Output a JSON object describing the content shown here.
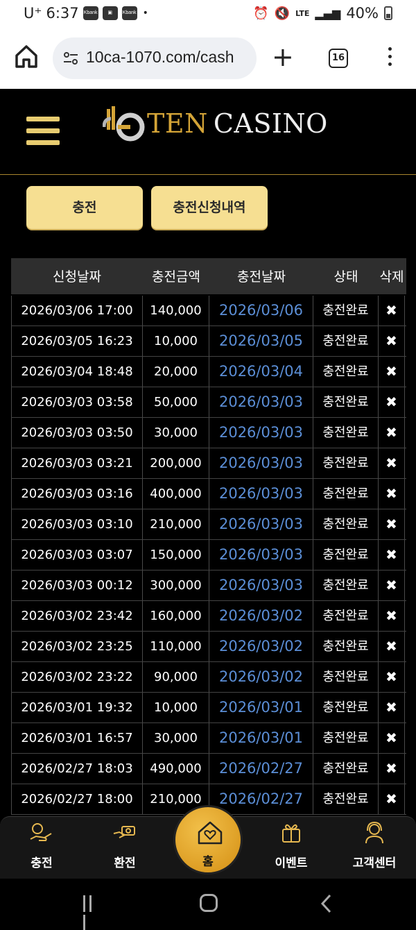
{
  "status_bar": {
    "carrier": "U⁺",
    "time": "6:37",
    "notif_icons": [
      "Kbank",
      "image",
      "Kbank"
    ],
    "more_dot": "•",
    "network": "LTE",
    "battery": "40%"
  },
  "browser": {
    "url": "10ca-1070.com/cash",
    "tab_count": "16",
    "home_icon": "home-icon",
    "new_tab_label": "+"
  },
  "site": {
    "logo_ten": "TEN",
    "logo_casino": "CASINO",
    "brand_color": "#d4a437"
  },
  "tabs": {
    "charge_label": "충전",
    "history_label": "충전신청내역"
  },
  "table": {
    "headers": [
      "신청날짜",
      "충전금액",
      "충전날짜",
      "상태",
      "삭제"
    ],
    "rows": [
      {
        "requested": "2026/03/06 17:00",
        "amount": "140,000",
        "charged": "2026/03/06",
        "status": "충전완료",
        "delete": "✖"
      },
      {
        "requested": "2026/03/05 16:23",
        "amount": "10,000",
        "charged": "2026/03/05",
        "status": "충전완료",
        "delete": "✖"
      },
      {
        "requested": "2026/03/04 18:48",
        "amount": "20,000",
        "charged": "2026/03/04",
        "status": "충전완료",
        "delete": "✖"
      },
      {
        "requested": "2026/03/03 03:58",
        "amount": "50,000",
        "charged": "2026/03/03",
        "status": "충전완료",
        "delete": "✖"
      },
      {
        "requested": "2026/03/03 03:50",
        "amount": "30,000",
        "charged": "2026/03/03",
        "status": "충전완료",
        "delete": "✖"
      },
      {
        "requested": "2026/03/03 03:21",
        "amount": "200,000",
        "charged": "2026/03/03",
        "status": "충전완료",
        "delete": "✖"
      },
      {
        "requested": "2026/03/03 03:16",
        "amount": "400,000",
        "charged": "2026/03/03",
        "status": "충전완료",
        "delete": "✖"
      },
      {
        "requested": "2026/03/03 03:10",
        "amount": "210,000",
        "charged": "2026/03/03",
        "status": "충전완료",
        "delete": "✖"
      },
      {
        "requested": "2026/03/03 03:07",
        "amount": "150,000",
        "charged": "2026/03/03",
        "status": "충전완료",
        "delete": "✖"
      },
      {
        "requested": "2026/03/03 00:12",
        "amount": "300,000",
        "charged": "2026/03/03",
        "status": "충전완료",
        "delete": "✖"
      },
      {
        "requested": "2026/03/02 23:42",
        "amount": "160,000",
        "charged": "2026/03/02",
        "status": "충전완료",
        "delete": "✖"
      },
      {
        "requested": "2026/03/02 23:25",
        "amount": "110,000",
        "charged": "2026/03/02",
        "status": "충전완료",
        "delete": "✖"
      },
      {
        "requested": "2026/03/02 23:22",
        "amount": "90,000",
        "charged": "2026/03/02",
        "status": "충전완료",
        "delete": "✖"
      },
      {
        "requested": "2026/03/01 19:32",
        "amount": "10,000",
        "charged": "2026/03/01",
        "status": "충전완료",
        "delete": "✖"
      },
      {
        "requested": "2026/03/01 16:57",
        "amount": "30,000",
        "charged": "2026/03/01",
        "status": "충전완료",
        "delete": "✖"
      },
      {
        "requested": "2026/02/27 18:03",
        "amount": "490,000",
        "charged": "2026/02/27",
        "status": "충전완료",
        "delete": "✖"
      },
      {
        "requested": "2026/02/27 18:00",
        "amount": "210,000",
        "charged": "2026/02/27",
        "status": "충전완료",
        "delete": "✖"
      }
    ]
  },
  "bottom_nav": {
    "charge": "충전",
    "exchange": "환전",
    "home": "홈",
    "event": "이벤트",
    "support": "고객센터"
  },
  "colors": {
    "accent_gold": "#f6df92",
    "link_blue": "#5b8ed6",
    "fab_orange": "#e6a72a"
  }
}
